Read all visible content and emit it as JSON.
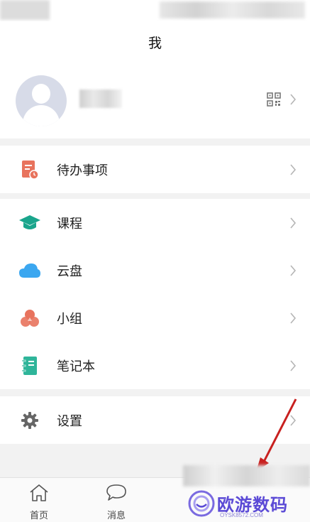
{
  "header": {
    "title": "我"
  },
  "profile": {
    "qr_icon": "qr-code-icon"
  },
  "menu": {
    "group1": [
      {
        "label": "待办事项",
        "icon": "todo-icon",
        "color": "#e8735d"
      }
    ],
    "group2": [
      {
        "label": "课程",
        "icon": "graduation-cap-icon",
        "color": "#1aa58c"
      },
      {
        "label": "云盘",
        "icon": "cloud-icon",
        "color": "#3ba7f0"
      },
      {
        "label": "小组",
        "icon": "group-icon",
        "color": "#e8735d"
      },
      {
        "label": "笔记本",
        "icon": "notebook-icon",
        "color": "#2fb59a"
      }
    ],
    "group3": [
      {
        "label": "设置",
        "icon": "gear-icon",
        "color": "#666666"
      }
    ]
  },
  "tabs": [
    {
      "label": "首页",
      "icon": "home-icon"
    },
    {
      "label": "消息",
      "icon": "chat-bubble-icon"
    }
  ],
  "watermark": {
    "text": "欧游数码",
    "sub": "OYSK8572.COM"
  }
}
